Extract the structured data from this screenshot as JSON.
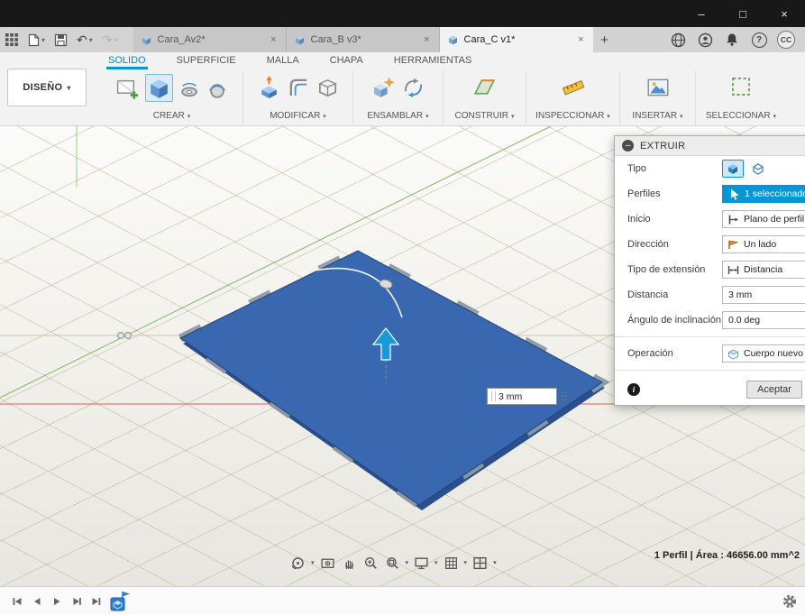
{
  "glyphs": {
    "caret": "▾",
    "close": "×",
    "minimize": "–",
    "maximize": "□",
    "plus": "+",
    "undo": "↶",
    "redo": "↷",
    "help": "?",
    "info": "i",
    "minus": "–"
  },
  "tabbar": {
    "tabs": [
      {
        "label": "Cara_Av2*"
      },
      {
        "label": "Cara_B v3*"
      },
      {
        "label": "Cara_C v1*"
      }
    ],
    "avatar": "CC"
  },
  "toolbar": {
    "workspace": "DISEÑO",
    "ribbon_tabs": [
      "SOLIDO",
      "SUPERFICIE",
      "MALLA",
      "CHAPA",
      "HERRAMIENTAS"
    ],
    "groups": [
      "CREAR",
      "MODIFICAR",
      "ENSAMBLAR",
      "CONSTRUIR",
      "INSPECCIONAR",
      "INSERTAR",
      "SELECCIONAR"
    ]
  },
  "dialog": {
    "title": "EXTRUIR",
    "rows": {
      "tipo": "Tipo",
      "perfiles": "Perfiles",
      "perfiles_value": "1 seleccionado",
      "inicio": "Inicio",
      "inicio_value": "Plano de perfil",
      "direccion": "Dirección",
      "direccion_value": "Un lado",
      "extension": "Tipo de extensión",
      "extension_value": "Distancia",
      "distancia": "Distancia",
      "distancia_value": "3 mm",
      "angulo": "Ángulo de inclinación",
      "angulo_value": "0.0 deg",
      "operacion": "Operación",
      "operacion_value": "Cuerpo nuevo"
    },
    "accept": "Aceptar"
  },
  "viewport": {
    "dim_value": "3 mm",
    "status": "1 Perfil | Área : 46656.00 mm^2"
  }
}
